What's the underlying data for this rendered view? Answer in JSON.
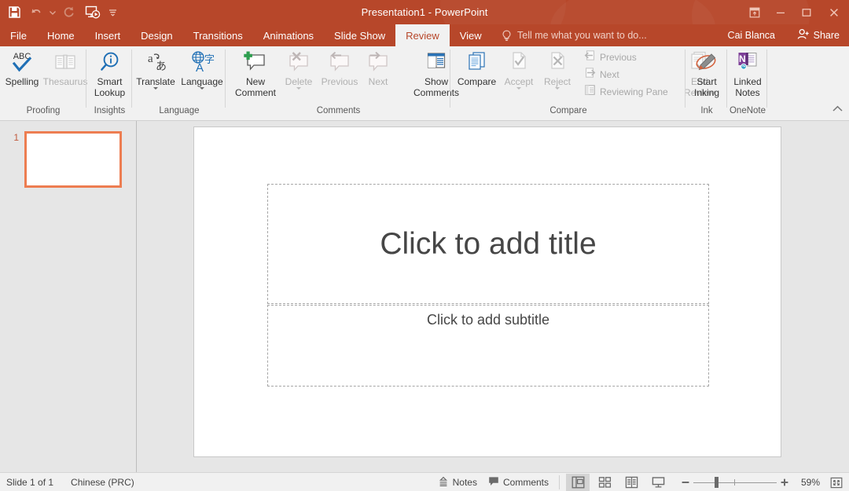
{
  "window": {
    "title": "Presentation1 - PowerPoint",
    "controls": {
      "ribbon_display_options": "ribbon-display-options",
      "minimize": "minimize",
      "restore": "restore",
      "close": "close"
    }
  },
  "quick_access": {
    "items": [
      {
        "name": "save-icon",
        "label": "Save"
      },
      {
        "name": "undo-icon",
        "label": "Undo"
      },
      {
        "name": "redo-icon",
        "label": "Redo"
      },
      {
        "name": "start-from-beginning-icon",
        "label": "Start From Beginning"
      },
      {
        "name": "customize-qat-icon",
        "label": "Customize Quick Access Toolbar"
      }
    ]
  },
  "tabs": [
    {
      "label": "File",
      "active": false
    },
    {
      "label": "Home",
      "active": false
    },
    {
      "label": "Insert",
      "active": false
    },
    {
      "label": "Design",
      "active": false
    },
    {
      "label": "Transitions",
      "active": false
    },
    {
      "label": "Animations",
      "active": false
    },
    {
      "label": "Slide Show",
      "active": false
    },
    {
      "label": "Review",
      "active": true
    },
    {
      "label": "View",
      "active": false
    }
  ],
  "tell_me": {
    "placeholder": "Tell me what you want to do..."
  },
  "account": {
    "user_name": "Cai Blanca",
    "share_label": "Share"
  },
  "ribbon": {
    "groups": [
      {
        "label": "Proofing",
        "buttons": [
          {
            "label": "Spelling",
            "icon": "abc-check-icon",
            "enabled": true,
            "dropdown": false
          },
          {
            "label": "Thesaurus",
            "icon": "book-icon",
            "enabled": false,
            "dropdown": false
          }
        ]
      },
      {
        "label": "Insights",
        "buttons": [
          {
            "label": "Smart\nLookup",
            "icon": "magnifier-info-icon",
            "enabled": true,
            "dropdown": false
          }
        ]
      },
      {
        "label": "Language",
        "buttons": [
          {
            "label": "Translate",
            "icon": "translate-icon",
            "enabled": true,
            "dropdown": true
          },
          {
            "label": "Language",
            "icon": "language-globe-icon",
            "enabled": true,
            "dropdown": true
          }
        ]
      },
      {
        "label": "Comments",
        "buttons": [
          {
            "label": "New\nComment",
            "icon": "new-comment-icon",
            "enabled": true,
            "dropdown": false
          },
          {
            "label": "Delete",
            "icon": "delete-comment-icon",
            "enabled": false,
            "dropdown": true
          },
          {
            "label": "Previous",
            "icon": "previous-comment-icon",
            "enabled": false,
            "dropdown": false
          },
          {
            "label": "Next",
            "icon": "next-comment-icon",
            "enabled": false,
            "dropdown": false
          },
          {
            "label": "Show\nComments",
            "icon": "show-comments-icon",
            "enabled": true,
            "dropdown": true
          }
        ]
      },
      {
        "label": "Compare",
        "buttons": [
          {
            "label": "Compare",
            "icon": "compare-icon",
            "enabled": true,
            "dropdown": false
          },
          {
            "label": "Accept",
            "icon": "accept-icon",
            "enabled": false,
            "dropdown": true
          },
          {
            "label": "Reject",
            "icon": "reject-icon",
            "enabled": false,
            "dropdown": true
          },
          {
            "label": "End\nReview",
            "icon": "end-review-icon",
            "enabled": false,
            "dropdown": false
          }
        ],
        "small_buttons": [
          {
            "label": "Previous",
            "icon": "previous-change-icon",
            "enabled": false
          },
          {
            "label": "Next",
            "icon": "next-change-icon",
            "enabled": false
          },
          {
            "label": "Reviewing Pane",
            "icon": "reviewing-pane-icon",
            "enabled": false
          }
        ]
      },
      {
        "label": "Ink",
        "buttons": [
          {
            "label": "Start\nInking",
            "icon": "start-inking-icon",
            "enabled": true,
            "dropdown": false
          }
        ]
      },
      {
        "label": "OneNote",
        "buttons": [
          {
            "label": "Linked\nNotes",
            "icon": "onenote-linked-notes-icon",
            "enabled": true,
            "dropdown": false
          }
        ]
      }
    ],
    "collapse_icon": "collapse-ribbon-icon"
  },
  "slides_panel": {
    "slides": [
      {
        "number": "1",
        "selected": true
      }
    ]
  },
  "slide": {
    "title_placeholder": "Click to add title",
    "subtitle_placeholder": "Click to add subtitle"
  },
  "status_bar": {
    "slide_count": "Slide 1 of 1",
    "language": "Chinese (PRC)",
    "notes_label": "Notes",
    "comments_label": "Comments",
    "views": [
      {
        "name": "normal-view-button",
        "selected": true
      },
      {
        "name": "slide-sorter-view-button",
        "selected": false
      },
      {
        "name": "reading-view-button",
        "selected": false
      },
      {
        "name": "slide-show-button",
        "selected": false
      }
    ],
    "zoom_out_label": "Zoom Out",
    "zoom_in_label": "Zoom In",
    "zoom_level": "59%",
    "fit_slide_label": "Fit slide to current window"
  },
  "colors": {
    "brand": "#b7472a",
    "accent_orange": "#ed7d51",
    "ribbon_bg": "#f1f1f1",
    "workspace_bg": "#e6e6e6"
  }
}
